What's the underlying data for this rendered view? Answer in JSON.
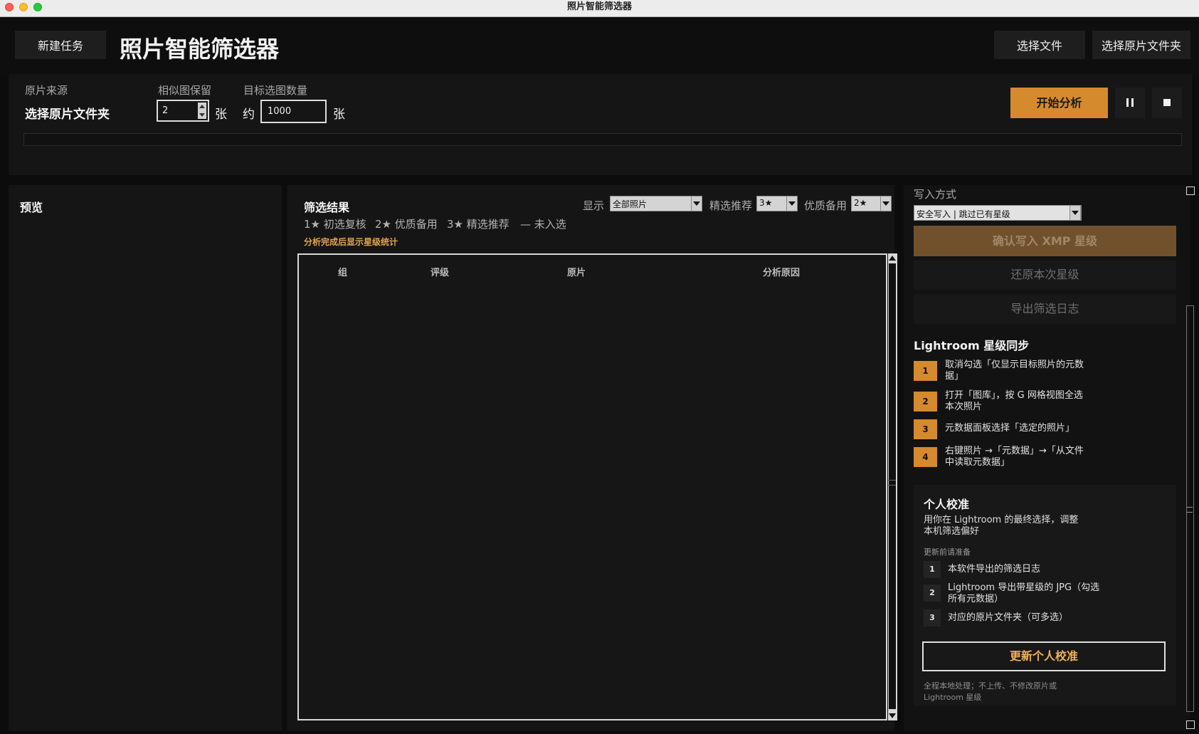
{
  "window": {
    "title": "照片智能筛选器"
  },
  "header": {
    "new_task_label": "新建任务",
    "app_title": "照片智能筛选器",
    "select_files_label": "选择文件",
    "select_folder_label": "选择原片文件夹"
  },
  "settings": {
    "source_label": "原片来源",
    "source_value": "选择原片文件夹",
    "similar_label": "相似图保留",
    "similar_value": "2",
    "similar_unit": "张",
    "target_label": "目标选图数量",
    "target_prefix": "约",
    "target_value": "1000",
    "target_unit": "张",
    "start_label": "开始分析",
    "progress": 0
  },
  "preview": {
    "title": "预览"
  },
  "results": {
    "title": "筛选结果",
    "legend": [
      "1★ 初选复核",
      "2★ 优质备用",
      "3★ 精选推荐",
      "— 未入选"
    ],
    "stat_note": "分析完成后显示星级统计",
    "filters": {
      "show_label": "显示",
      "show_value": "全部照片",
      "pick_label": "精选推荐",
      "pick_value": "3★",
      "backup_label": "优质备用",
      "backup_value": "2★"
    },
    "columns": [
      "组",
      "评级",
      "原片",
      "分析原因"
    ],
    "rows": []
  },
  "right": {
    "write_mode_label": "写入方式",
    "write_mode_value": "安全写入 | 跳过已有星级",
    "confirm_label": "确认写入 XMP 星级",
    "restore_label": "还原本次星级",
    "export_log_label": "导出筛选日志",
    "lr_title": "Lightroom 星级同步",
    "lr_steps": [
      {
        "num": "1",
        "text": "取消勾选「仅显示目标照片的元数据」"
      },
      {
        "num": "2",
        "text": "打开「图库」，按 G 网格视图全选本次照片"
      },
      {
        "num": "3",
        "text": "元数据面板选择「选定的照片」"
      },
      {
        "num": "4",
        "text": "右键照片 →「元数据」→「从文件中读取元数据」"
      }
    ],
    "calib": {
      "title": "个人校准",
      "desc": "用你在 Lightroom 的最终选择，调整本机筛选偏好",
      "sub": "更新前请准备",
      "items": [
        {
          "num": "1",
          "text": "本软件导出的筛选日志"
        },
        {
          "num": "2",
          "text": "Lightroom 导出带星级的 JPG（勾选所有元数据）"
        },
        {
          "num": "3",
          "text": "对应的原片文件夹（可多选）"
        }
      ],
      "update_label": "更新个人校准",
      "footnote": "全程本地处理；不上传、不修改原片或 Lightroom 星级"
    }
  },
  "colors": {
    "accent": "#d58a2d",
    "accent_dim": "#70512b",
    "background": "#0c0c0c",
    "panel": "#151515"
  }
}
